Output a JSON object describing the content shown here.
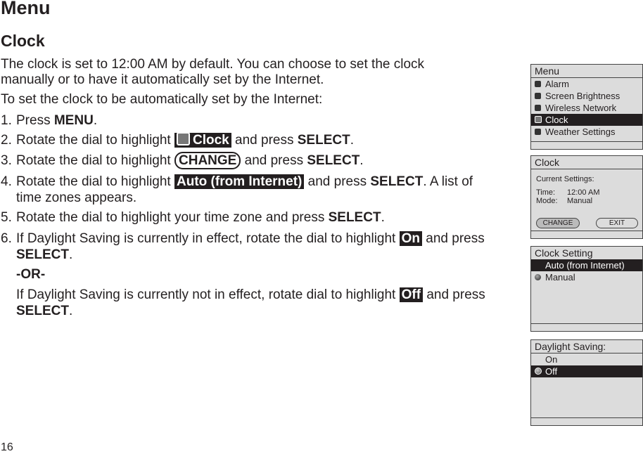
{
  "heading": "Menu",
  "subheading": "Clock",
  "intro": [
    "The clock is set to 12:00 AM by default. You can choose to set the clock",
    "manually or to have it automatically set by the Internet."
  ],
  "lead": "To set the clock to be automatically set by the Internet:",
  "steps": [
    {
      "num": "1.",
      "pre": "Press ",
      "bold": "MENU",
      "post": "."
    },
    {
      "num": "2.",
      "pre": "Rotate the dial to highlight ",
      "hl": "Clock",
      "mid": " and press ",
      "bold": "SELECT",
      "post": "."
    },
    {
      "num": "3.",
      "pre": "Rotate the dial to highlight ",
      "hl": "CHANGE",
      "mid": " and press ",
      "bold": "SELECT",
      "post": "."
    },
    {
      "num": "4.",
      "pre": "Rotate the dial to highlight ",
      "hl": "Auto (from Internet)",
      "mid": " and press ",
      "bold": "SELECT",
      "post": ". A list of",
      "cont": "time zones appears."
    },
    {
      "num": "5.",
      "pre": "Rotate the dial to highlight your time zone and press ",
      "bold": "SELECT",
      "post": "."
    },
    {
      "num": "6.",
      "pre": "If Daylight Saving is currently in effect, rotate the dial to highlight ",
      "hl": "On",
      "mid": " and press",
      "bold2": "SELECT",
      "post": "."
    }
  ],
  "or": "-OR-",
  "alt": {
    "pre": "If Daylight Saving is currently not in effect, rotate dial to highlight ",
    "hl": "Off",
    "mid": " and press",
    "bold": "SELECT",
    "post": "."
  },
  "page_number": "16",
  "screens": {
    "menu": {
      "title": "Menu",
      "items": [
        "Alarm",
        "Screen Brightness",
        "Wireless Network",
        "Clock",
        "Weather Settings"
      ],
      "selected": "Clock"
    },
    "clock": {
      "title": "Clock",
      "current": "Current Settings:",
      "time_label": "Time:",
      "time_value": "12:00 AM",
      "mode_label": "Mode:",
      "mode_value": "Manual",
      "change": "CHANGE",
      "exit": "EXIT"
    },
    "clock_setting": {
      "title": "Clock Setting",
      "items": [
        "Auto (from Internet)",
        "Manual"
      ],
      "selected": "Auto (from Internet)"
    },
    "dst": {
      "title": "Daylight Saving:",
      "items": [
        "On",
        "Off"
      ],
      "selected": "Off"
    }
  }
}
